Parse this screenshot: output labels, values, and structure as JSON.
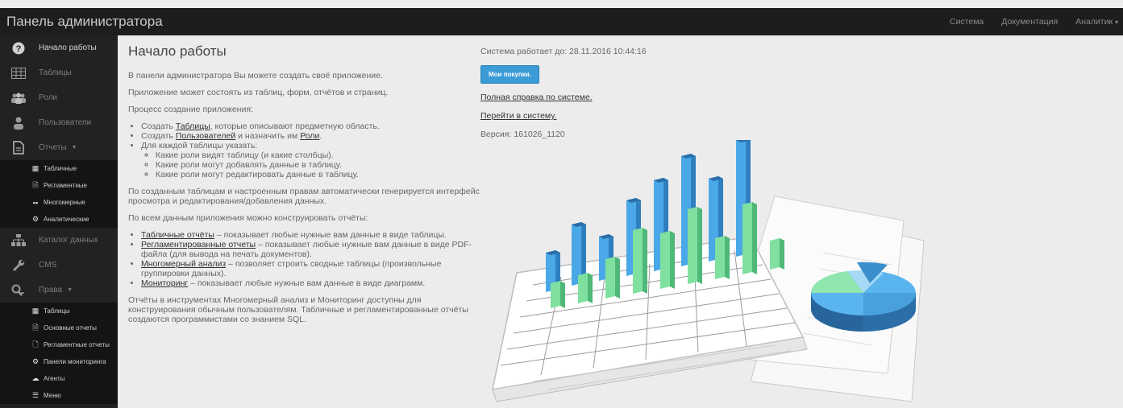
{
  "header": {
    "brand": "Панель администратора",
    "nav": [
      {
        "label": "Система"
      },
      {
        "label": "Документация"
      },
      {
        "label": "Аналитик"
      }
    ]
  },
  "sidebar": {
    "items": [
      {
        "label": "Начало работы",
        "icon": "question-icon"
      },
      {
        "label": "Таблицы",
        "icon": "table-icon"
      },
      {
        "label": "Роли",
        "icon": "group-icon"
      },
      {
        "label": "Пользователи",
        "icon": "user-icon"
      },
      {
        "label": "Отчеты",
        "icon": "document-icon"
      },
      {
        "label": "Каталог данных",
        "icon": "sitemap-icon"
      },
      {
        "label": "CMS",
        "icon": "wrench-icon"
      },
      {
        "label": "Права",
        "icon": "key-search-icon"
      }
    ],
    "reports_sub": [
      "Табличные",
      "Регламентные",
      "Многомерные",
      "Аналитические"
    ],
    "rights_sub": [
      "Таблицы",
      "Основные отчеты",
      "Регламентные отчеты",
      "Панели мониторинга",
      "Агенты",
      "Меню"
    ]
  },
  "main": {
    "title": "Начало работы",
    "intro1": "В панели администратора Вы можете создать своё приложение.",
    "intro2": "Приложение может состоять из таблиц, форм, отчётов и страниц.",
    "process_title": "Процесс создание приложения:",
    "step1_pre": "Создать ",
    "step1_link": "Таблицы",
    "step1_post": ", которые описывают предметную область.",
    "step2_pre": "Создать ",
    "step2_link1": "Пользователей",
    "step2_mid": " и назначить им ",
    "step2_link2": "Роли",
    "step2_post": ".",
    "step3": "Для каждой таблицы указать:",
    "step3_sub": [
      "Какие роли видят таблицу (и какие столбцы).",
      "Какие роли могут добавлять данные в таблицу.",
      "Какие роли могут редактировать данные в таблицу."
    ],
    "auto_text": "По созданным таблицам и настроенным правам автоматически генерируется интерфейс просмотра и редактирования/добавления данных.",
    "reports_intro": "По всем данным приложения можно конструировать отчёты:",
    "r1_link": "Табличные отчёты",
    "r1_text": " – показывает любые нужные вам данные в виде таблицы.",
    "r2_link": "Регламентированные отчеты",
    "r2_text": " – показывает любые нужные вам данные в виде PDF-файла (для вывода на печать документов).",
    "r3_link": "Многомерный анализ",
    "r3_text": " – позволяет строить сводные таблицы (произвольные группировки данных).",
    "r4_link": "Мониторинг",
    "r4_text": " – показывает любые нужные вам данные в виде диаграмм.",
    "footer_text": "Отчёты в инструментах Многомерный анализ и Мониторинг доступны для конструирования обычным пользователям. Табличные и регламентированные отчёты создаются программистами со знанием SQL."
  },
  "info": {
    "system_until": "Система работает до: 28.11.2016 10:44:16",
    "purchases_button": "Мои покупки.",
    "help_link": "Полная справка по системе.",
    "go_link": "Перейти в систему.",
    "version": "Версия: 161026_1120"
  },
  "colors": {
    "topbar": "#1b1d1f",
    "sidebar": "#222222",
    "accent": "#3a9bd6",
    "bar_blue": "#4aa8e8",
    "bar_green": "#7fe0a0"
  }
}
